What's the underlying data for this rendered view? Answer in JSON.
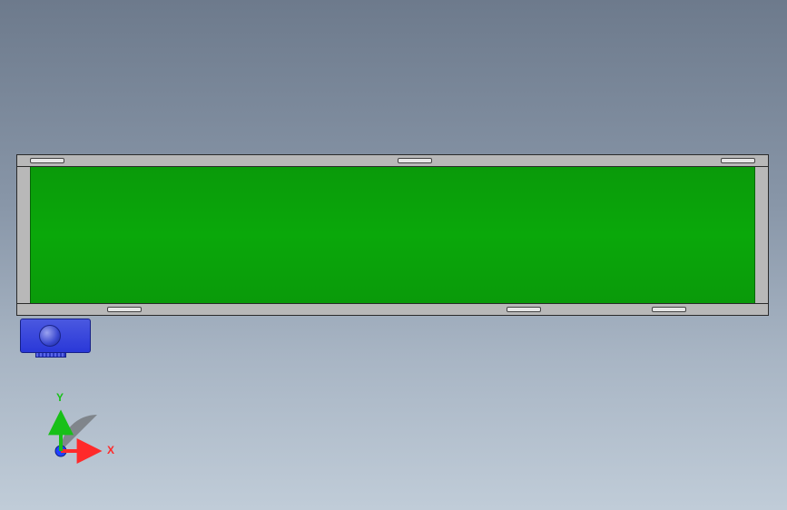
{
  "model": {
    "belt_color": "#0aa80a",
    "frame_color": "#b8b8b8",
    "motor_color": "#2a38d8"
  },
  "triad": {
    "x_label": "X",
    "y_label": "Y",
    "x_color": "#ff2a2a",
    "y_color": "#18c018",
    "z_color": "#2040ff"
  }
}
